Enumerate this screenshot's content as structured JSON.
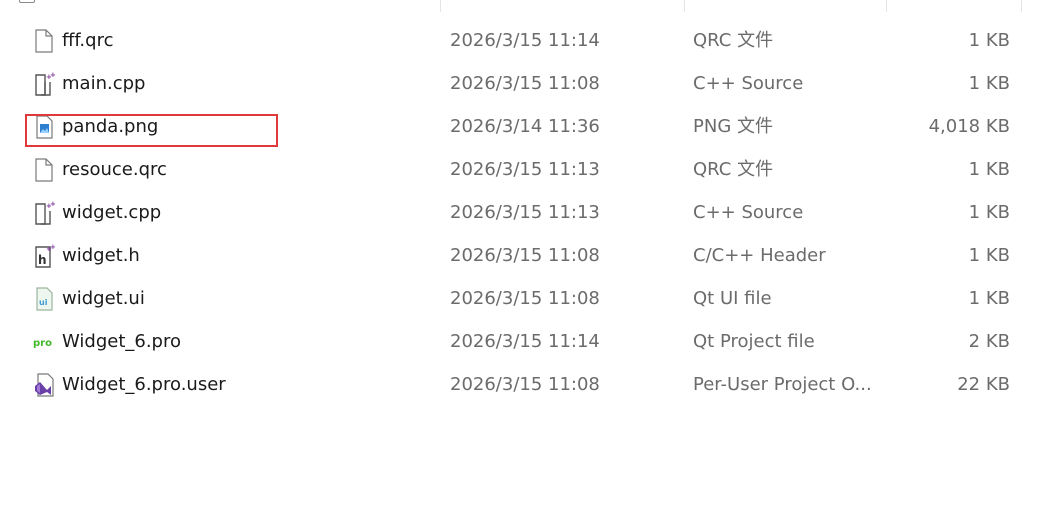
{
  "files": [
    {
      "name": "fff.qrc",
      "date": "2026/3/15 11:14",
      "type": "QRC 文件",
      "size": "1 KB",
      "icon": "generic-file-icon"
    },
    {
      "name": "main.cpp",
      "date": "2026/3/15 11:08",
      "type": "C++ Source",
      "size": "1 KB",
      "icon": "cpp-file-icon"
    },
    {
      "name": "panda.png",
      "date": "2026/3/14 11:36",
      "type": "PNG 文件",
      "size": "4,018 KB",
      "icon": "image-file-icon"
    },
    {
      "name": "resouce.qrc",
      "date": "2026/3/15 11:13",
      "type": "QRC 文件",
      "size": "1 KB",
      "icon": "generic-file-icon"
    },
    {
      "name": "widget.cpp",
      "date": "2026/3/15 11:13",
      "type": "C++ Source",
      "size": "1 KB",
      "icon": "cpp-file-icon"
    },
    {
      "name": "widget.h",
      "date": "2026/3/15 11:08",
      "type": "C/C++ Header",
      "size": "1 KB",
      "icon": "header-file-icon"
    },
    {
      "name": "widget.ui",
      "date": "2026/3/15 11:08",
      "type": "Qt UI file",
      "size": "1 KB",
      "icon": "ui-file-icon"
    },
    {
      "name": "Widget_6.pro",
      "date": "2026/3/15 11:14",
      "type": "Qt Project file",
      "size": "2 KB",
      "icon": "pro-file-icon"
    },
    {
      "name": "Widget_6.pro.user",
      "date": "2026/3/15 11:08",
      "type": "Per-User Project O...",
      "size": "22 KB",
      "icon": "visualstudio-file-icon"
    }
  ],
  "highlighted_file": "panda.png",
  "highlight_color": "#e0393c"
}
